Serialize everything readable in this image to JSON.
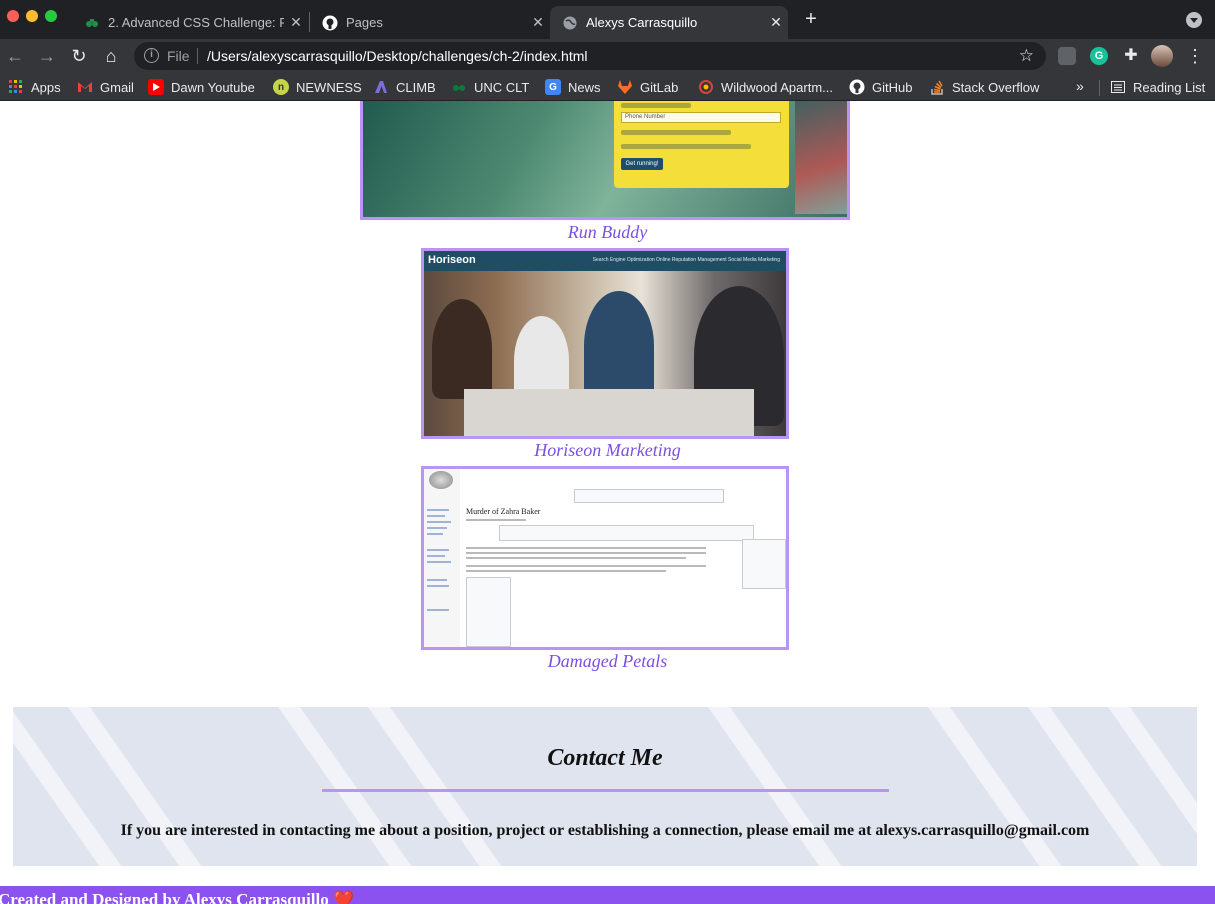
{
  "browser": {
    "tabs": [
      {
        "title": "2. Advanced CSS Challenge: P",
        "favicon": "bootcamp-icon",
        "active": false
      },
      {
        "title": "Pages",
        "favicon": "github-icon",
        "active": false
      },
      {
        "title": "Alexys Carrasquillo",
        "favicon": "globe-icon",
        "active": true
      }
    ],
    "new_tab_label": "+",
    "address": {
      "scheme": "File",
      "url": "/Users/alexyscarrasquillo/Desktop/challenges/ch-2/index.html"
    },
    "bookmarks": [
      {
        "label": "Apps",
        "icon": "apps-grid-icon",
        "color": "#ea4335"
      },
      {
        "label": "Gmail",
        "icon": "gmail-icon",
        "color": "#ea4335"
      },
      {
        "label": "Dawn Youtube",
        "icon": "youtube-icon",
        "color": "#ff0000"
      },
      {
        "label": "NEWNESS",
        "icon": "newness-icon",
        "color": "#c6d44a"
      },
      {
        "label": "CLIMB",
        "icon": "climb-icon",
        "color": "#7c6fd9"
      },
      {
        "label": "UNC CLT",
        "icon": "unc-icon",
        "color": "#0b7a3b"
      },
      {
        "label": "News",
        "icon": "news-icon",
        "color": "#4285f4"
      },
      {
        "label": "GitLab",
        "icon": "gitlab-icon",
        "color": "#fc6d26"
      },
      {
        "label": "Wildwood Apartm...",
        "icon": "wildwood-icon",
        "color": "#db4437"
      },
      {
        "label": "GitHub",
        "icon": "github-icon",
        "color": "#ffffff"
      },
      {
        "label": "Stack Overflow",
        "icon": "stackoverflow-icon",
        "color": "#f48024"
      }
    ],
    "bookmarks_overflow": "»",
    "reading_list": "Reading List",
    "grammarly_letter": "G"
  },
  "page": {
    "projects": [
      {
        "caption": "Run Buddy"
      },
      {
        "caption": "Horiseon Marketing"
      },
      {
        "caption": "Damaged Petals"
      }
    ],
    "runbuddy_form": {
      "phone_placeholder": "Phone Number",
      "button": "Get running!"
    },
    "horiseon": {
      "logo": "Horiseon",
      "nav": "Search Engine Optimization    Online Reputation Management    Social Media Marketing"
    },
    "wiki": {
      "article_title": "Murder of Zahra Baker"
    },
    "contact": {
      "title": "Contact Me",
      "text": "If you are interested in contacting me about a position, project or establishing a connection, please email me at alexys.carrasquillo@gmail.com"
    },
    "footer": {
      "text": "Created and Designed by Alexys Carrasquillo",
      "heart": "❤️"
    },
    "colors": {
      "accent": "#b794f6",
      "caption": "#7b4fe0",
      "footer": "#8c52f0",
      "contact_bg": "#dfe4ef"
    }
  }
}
